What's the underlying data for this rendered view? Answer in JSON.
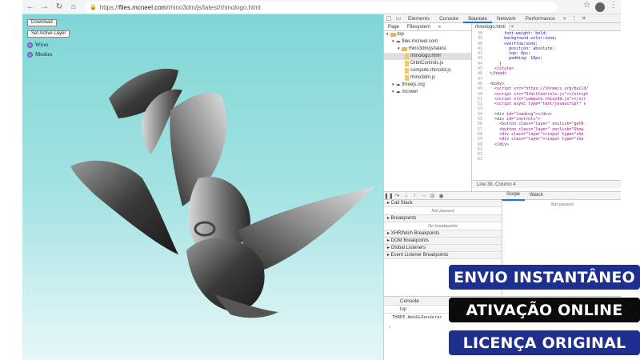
{
  "browser": {
    "url_prefix": "https://",
    "url_host": "files.mcneel.com",
    "url_path": "/rhino3dm/js/latest/rhinologo.html"
  },
  "scene": {
    "button_download": "Download",
    "button_set_active": "Set Active Layer",
    "layers": [
      "Wires",
      "Meshes"
    ]
  },
  "devtools": {
    "tabs": [
      "Elements",
      "Console",
      "Sources",
      "Network",
      "Performance"
    ],
    "active_tab": "Sources",
    "nav_tabs": [
      "Page",
      "Filesystem"
    ],
    "tree": [
      {
        "label": "top",
        "kind": "folder",
        "indent": 0
      },
      {
        "label": "files.mcneel.com",
        "kind": "cloud",
        "indent": 1
      },
      {
        "label": "rhino3dm/js/latest",
        "kind": "folder",
        "indent": 2
      },
      {
        "label": "rhinologo.html",
        "kind": "file",
        "indent": 3,
        "selected": true
      },
      {
        "label": "OrbitControls.js",
        "kind": "file",
        "indent": 3
      },
      {
        "label": "compute.rhino3d.js",
        "kind": "file",
        "indent": 3
      },
      {
        "label": "rhino3dm.js",
        "kind": "file",
        "indent": 3
      },
      {
        "label": "threejs.org",
        "kind": "cloud",
        "indent": 1
      },
      {
        "label": "mcneel",
        "kind": "cloud",
        "indent": 1
      }
    ],
    "editor_tab": "rhinologo.html",
    "code": [
      {
        "n": "38",
        "t": "        font-weight: bold;",
        "cls": ""
      },
      {
        "n": "39",
        "t": "        background-color:none;",
        "cls": ""
      },
      {
        "n": "40",
        "t": "        overflow:none;",
        "cls": ""
      },
      {
        "n": "41",
        "t": "          position: absolute;",
        "cls": ""
      },
      {
        "n": "42",
        "t": "          top: 0px;",
        "cls": ""
      },
      {
        "n": "43",
        "t": "          padding: 10px;",
        "cls": ""
      },
      {
        "n": "44",
        "t": "      }",
        "cls": ""
      },
      {
        "n": "45",
        "t": "    </style>",
        "cls": "tag"
      },
      {
        "n": "46",
        "t": "  </head>",
        "cls": "tag"
      },
      {
        "n": "47",
        "t": "",
        "cls": ""
      },
      {
        "n": "48",
        "t": "  <body>",
        "cls": "tag"
      },
      {
        "n": "49",
        "t": "    <script src=\"https://threejs.org/build/",
        "cls": "tag"
      },
      {
        "n": "50",
        "t": "    <script src=\"OrbitControls.js\"></script",
        "cls": "tag"
      },
      {
        "n": "51",
        "t": "    <script src=\"compute.rhino3d.js\"></scr",
        "cls": "tag"
      },
      {
        "n": "52",
        "t": "    <script async type=\"text/javascript\" s",
        "cls": "tag"
      },
      {
        "n": "53",
        "t": "",
        "cls": ""
      },
      {
        "n": "54",
        "t": "    <div id=\"loading\"></div>",
        "cls": "tag"
      },
      {
        "n": "55",
        "t": "    <div id=\"controls\">",
        "cls": "tag"
      },
      {
        "n": "56",
        "t": "      <button class=\"layer\" onclick=\"getR",
        "cls": "tag"
      },
      {
        "n": "57",
        "t": "      <button class=\"layer\" onclick=\"Show",
        "cls": "tag"
      },
      {
        "n": "58",
        "t": "      <div class=\"layer\"><input type=\"che",
        "cls": "tag"
      },
      {
        "n": "59",
        "t": "      <div class=\"layer\"><input type=\"che",
        "cls": "tag"
      },
      {
        "n": "60",
        "t": "    </div>",
        "cls": "tag"
      },
      {
        "n": "61",
        "t": "",
        "cls": ""
      },
      {
        "n": "62",
        "t": "",
        "cls": ""
      },
      {
        "n": "63",
        "t": "",
        "cls": ""
      }
    ],
    "status": "Line 38, Column 4",
    "scope_tabs": [
      "Scope",
      "Watch"
    ],
    "not_paused": "Not paused",
    "sections": [
      {
        "head": "Call Stack",
        "body": "Not paused"
      },
      {
        "head": "Breakpoints",
        "body": "No breakpoints"
      },
      {
        "head": "XHR/fetch Breakpoints",
        "body": ""
      },
      {
        "head": "DOM Breakpoints",
        "body": ""
      },
      {
        "head": "Global Listeners",
        "body": ""
      },
      {
        "head": "Event Listener Breakpoints",
        "body": ""
      }
    ],
    "console_title": "Console",
    "console_context": "top",
    "console_log": "THREE.WebGLRenderer"
  },
  "promo": {
    "line1": "ENVIO INSTANTÂNEO",
    "line2": "ATIVAÇÃO ONLINE",
    "line3": "LICENÇA ORIGINAL"
  },
  "colors": {
    "promo_blue": "#1e2f8f",
    "promo_black": "#0b0b0b",
    "viewport_top": "#7fd6d6"
  }
}
